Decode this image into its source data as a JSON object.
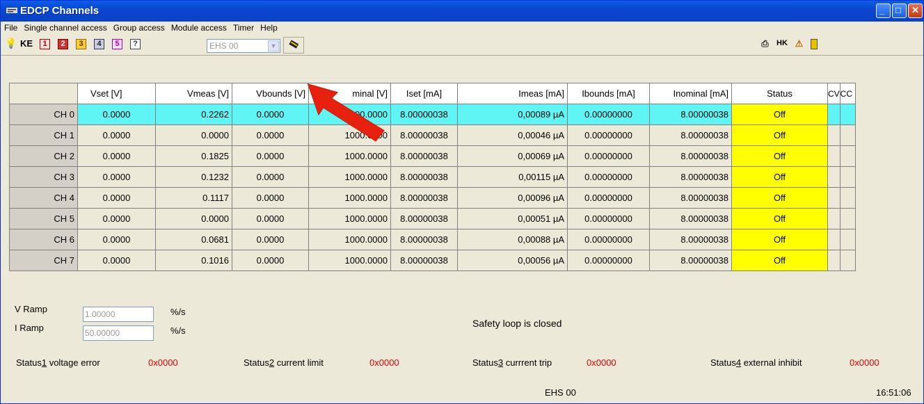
{
  "window": {
    "title": "EDCP Channels"
  },
  "menu": [
    "File",
    "Single channel access",
    "Group access",
    "Module access",
    "Timer",
    "Help"
  ],
  "toolbar": {
    "left_icons": [
      "bulb-icon",
      "ke-icon",
      "slot-1-icon",
      "slot-2-icon",
      "slot-3-icon",
      "slot-4-icon",
      "slot-5-icon",
      "help-icon"
    ],
    "ke_label": "KE",
    "slot_labels": [
      "1",
      "2",
      "3",
      "4",
      "5",
      "?"
    ],
    "module_select": "EHS 00",
    "right_icons": [
      "network-icon",
      "hk-icon",
      "alarm-icon",
      "exit-icon"
    ],
    "hk_label": "HK"
  },
  "table": {
    "headers": [
      "",
      "Vset [V]",
      "Vmeas [V]",
      "Vbounds [V]",
      "Vnominal [V]",
      "Iset [mA]",
      "Imeas [mA]",
      "Ibounds [mA]",
      "Inominal [mA]",
      "Status",
      "CV",
      "CC"
    ],
    "header_nominal_visible": "minal [V]",
    "rows": [
      {
        "ch": "CH 0",
        "vset": "0.0000",
        "vmeas": "0.2262",
        "vbounds": "0.0000",
        "vnom": "1000.0000",
        "iset": "8.00000038",
        "imeas": "0,00089 µA",
        "ibounds": "0.00000000",
        "inom": "8.00000038",
        "status": "Off"
      },
      {
        "ch": "CH 1",
        "vset": "0.0000",
        "vmeas": "0.0000",
        "vbounds": "0.0000",
        "vnom": "1000.0000",
        "iset": "8.00000038",
        "imeas": "0,00046 µA",
        "ibounds": "0.00000000",
        "inom": "8.00000038",
        "status": "Off"
      },
      {
        "ch": "CH 2",
        "vset": "0.0000",
        "vmeas": "0.1825",
        "vbounds": "0.0000",
        "vnom": "1000.0000",
        "iset": "8.00000038",
        "imeas": "0,00069 µA",
        "ibounds": "0.00000000",
        "inom": "8.00000038",
        "status": "Off"
      },
      {
        "ch": "CH 3",
        "vset": "0.0000",
        "vmeas": "0.1232",
        "vbounds": "0.0000",
        "vnom": "1000.0000",
        "iset": "8.00000038",
        "imeas": "0,00115 µA",
        "ibounds": "0.00000000",
        "inom": "8.00000038",
        "status": "Off"
      },
      {
        "ch": "CH 4",
        "vset": "0.0000",
        "vmeas": "0.1117",
        "vbounds": "0.0000",
        "vnom": "1000.0000",
        "iset": "8.00000038",
        "imeas": "0,00096 µA",
        "ibounds": "0.00000000",
        "inom": "8.00000038",
        "status": "Off"
      },
      {
        "ch": "CH 5",
        "vset": "0.0000",
        "vmeas": "0.0000",
        "vbounds": "0.0000",
        "vnom": "1000.0000",
        "iset": "8.00000038",
        "imeas": "0,00051 µA",
        "ibounds": "0.00000000",
        "inom": "8.00000038",
        "status": "Off"
      },
      {
        "ch": "CH 6",
        "vset": "0.0000",
        "vmeas": "0.0681",
        "vbounds": "0.0000",
        "vnom": "1000.0000",
        "iset": "8.00000038",
        "imeas": "0,00088 µA",
        "ibounds": "0.00000000",
        "inom": "8.00000038",
        "status": "Off"
      },
      {
        "ch": "CH 7",
        "vset": "0.0000",
        "vmeas": "0.1016",
        "vbounds": "0.0000",
        "vnom": "1000.0000",
        "iset": "8.00000038",
        "imeas": "0,00056 µA",
        "ibounds": "0.00000000",
        "inom": "8.00000038",
        "status": "Off"
      }
    ]
  },
  "ramps": {
    "v_label": "V Ramp",
    "v_value": "1.00000",
    "v_unit": "%/s",
    "i_label": "I Ramp",
    "i_value": "50.00000",
    "i_unit": "%/s"
  },
  "safety_loop": "Safety loop is closed",
  "status_flags": [
    {
      "label_pre": "Status",
      "num": "1",
      "label_post": " voltage error",
      "value": "0x0000"
    },
    {
      "label_pre": "Status",
      "num": "2",
      "label_post": " current limit",
      "value": "0x0000"
    },
    {
      "label_pre": "Status",
      "num": "3",
      "label_post": " currrent trip",
      "value": "0x0000"
    },
    {
      "label_pre": "Status",
      "num": "4",
      "label_post": " external inhibit",
      "value": "0x0000"
    }
  ],
  "statusbar": {
    "module": "EHS 00",
    "time": "16:51:06"
  },
  "colors": {
    "selected_row": "#5ff5f5",
    "status_off": "#ffff00",
    "status_value": "#e00000",
    "titlebar": "#0a46cf",
    "annotation_arrow": "#e8200e"
  }
}
